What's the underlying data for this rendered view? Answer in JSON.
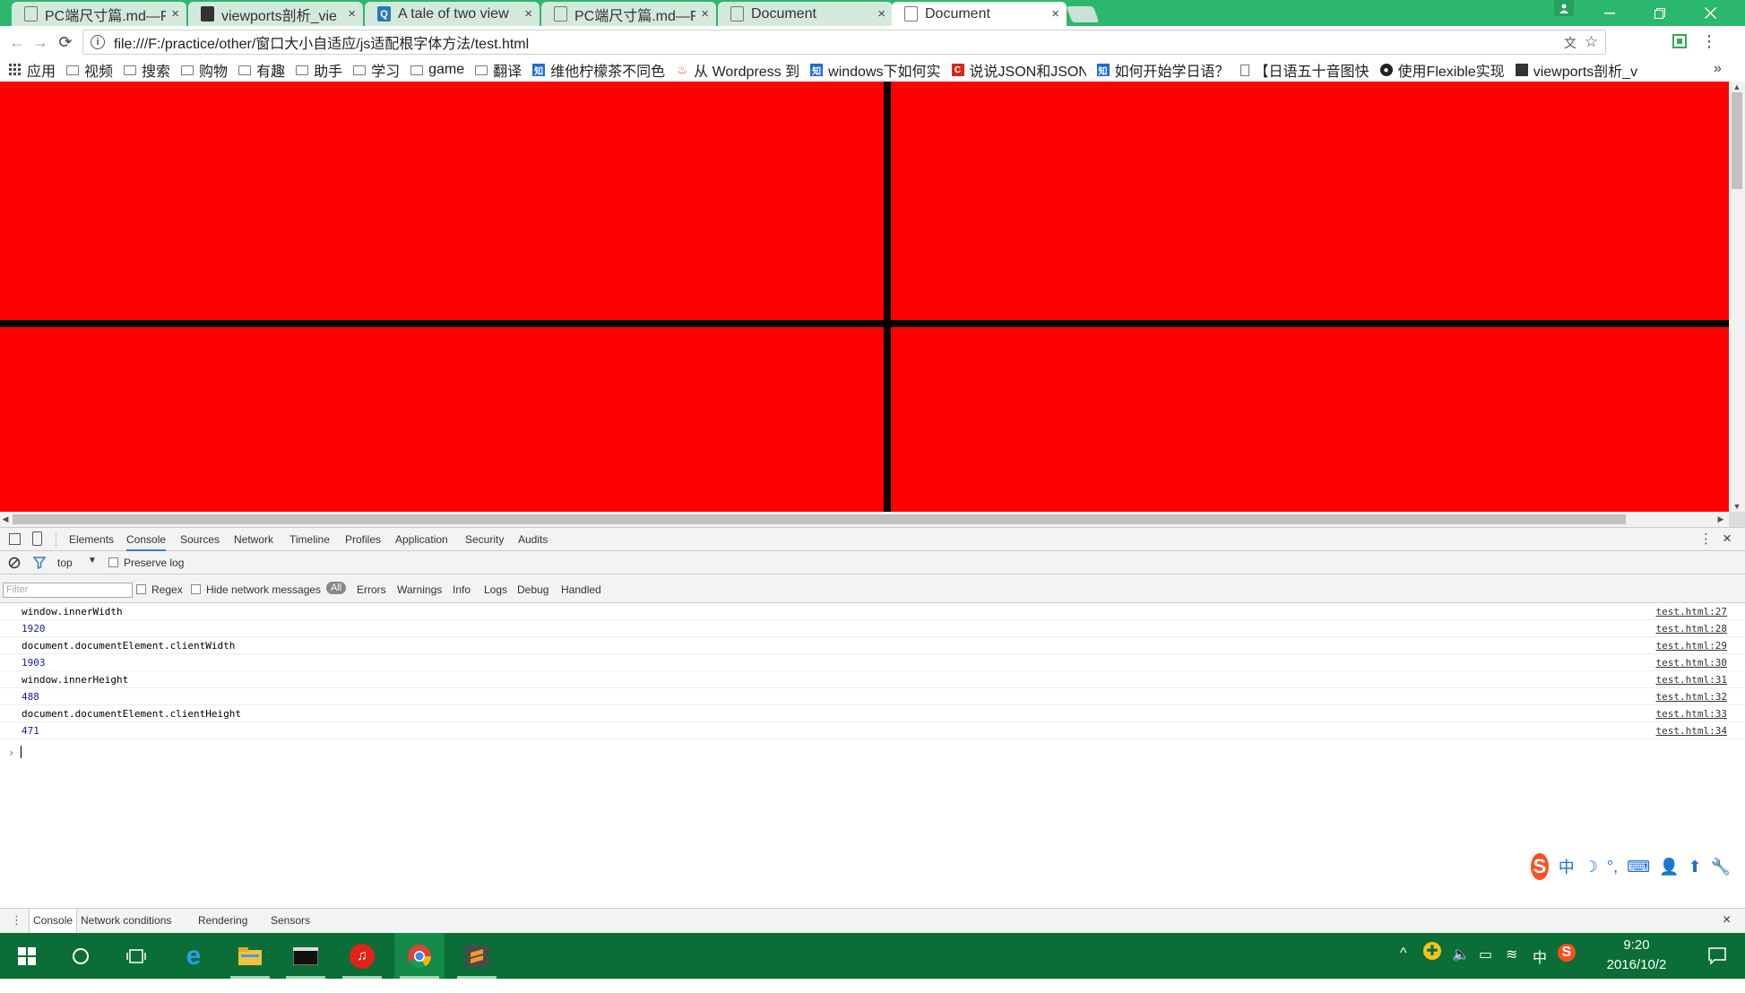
{
  "tabs": [
    {
      "label": "PC端尺寸篇.md—F",
      "icon": "document-icon"
    },
    {
      "label": "viewports剖析_vie",
      "icon": "site-favicon"
    },
    {
      "label": "A tale of two view",
      "icon": "q-favicon"
    },
    {
      "label": "PC端尺寸篇.md—F",
      "icon": "document-icon"
    },
    {
      "label": "Document",
      "icon": "document-icon"
    },
    {
      "label": "Document",
      "icon": "document-icon",
      "active": true
    }
  ],
  "toolbar": {
    "back": "←",
    "forward": "→",
    "reload": "⟳",
    "url": "file:///F:/practice/other/窗口大小自适应/js适配根字体方法/test.html",
    "info": "i",
    "translate": "文",
    "star": "☆",
    "ext": "■",
    "menu": "⋮"
  },
  "bookmarks": [
    {
      "label": "应用",
      "icon": "apps-grid-icon"
    },
    {
      "label": "视频",
      "icon": "folder-icon"
    },
    {
      "label": "搜索",
      "icon": "folder-icon"
    },
    {
      "label": "购物",
      "icon": "folder-icon"
    },
    {
      "label": "有趣",
      "icon": "folder-icon"
    },
    {
      "label": "助手",
      "icon": "folder-icon"
    },
    {
      "label": "学习",
      "icon": "folder-icon"
    },
    {
      "label": "game",
      "icon": "folder-icon"
    },
    {
      "label": "翻译",
      "icon": "folder-icon"
    },
    {
      "label": "维他柠檬茶不同色",
      "icon": "zhihu-icon"
    },
    {
      "label": "从 Wordpress 到",
      "icon": "flame-icon"
    },
    {
      "label": "windows下如何实",
      "icon": "zhihu-icon"
    },
    {
      "label": "说说JSON和JSON",
      "icon": "c-red-icon"
    },
    {
      "label": "如何开始学日语？",
      "icon": "zhihu-icon"
    },
    {
      "label": "【日语五十音图快",
      "icon": "page-icon"
    },
    {
      "label": "使用Flexible实现",
      "icon": "github-icon"
    },
    {
      "label": "viewports剖析_v",
      "icon": "site-favicon"
    }
  ],
  "bookmarks_more": "»",
  "devtools": {
    "tabs": [
      "Elements",
      "Console",
      "Sources",
      "Network",
      "Timeline",
      "Profiles",
      "Application",
      "Security",
      "Audits"
    ],
    "active_tab": "Console",
    "context": "top",
    "preserve_log": "Preserve log",
    "filter_placeholder": "Filter",
    "regex": "Regex",
    "hide_network": "Hide network messages",
    "levels": [
      "All",
      "Errors",
      "Warnings",
      "Info",
      "Logs",
      "Debug",
      "Handled"
    ],
    "close": "×",
    "more": "⋮"
  },
  "console_log": [
    {
      "msg": "window.innerWidth",
      "src": "test.html:27"
    },
    {
      "msg": "1920",
      "src": "test.html:28",
      "numeric": true
    },
    {
      "msg": "document.documentElement.clientWidth",
      "src": "test.html:29"
    },
    {
      "msg": "1903",
      "src": "test.html:30",
      "numeric": true
    },
    {
      "msg": "window.innerHeight",
      "src": "test.html:31"
    },
    {
      "msg": "488",
      "src": "test.html:32",
      "numeric": true
    },
    {
      "msg": "document.documentElement.clientHeight",
      "src": "test.html:33"
    },
    {
      "msg": "471",
      "src": "test.html:34",
      "numeric": true
    }
  ],
  "console_prompt": "›",
  "drawer": {
    "tabs": [
      "Console",
      "Network conditions",
      "Rendering",
      "Sensors"
    ],
    "active": "Console",
    "close": "×"
  },
  "ime": {
    "logo": "S",
    "mode": "中",
    "items": [
      "☽",
      "°,",
      "⌨",
      "👤",
      "⬆",
      "🔧"
    ]
  },
  "taskbar": {
    "tray": [
      "^",
      "✚",
      "🔈",
      "▭",
      "≋",
      "中",
      "S"
    ],
    "time": "9:20",
    "date": "2016/10/2"
  },
  "colors": {
    "page_bg": "#ff0000",
    "divider": "#000000",
    "tabstrip": "#2cb76f",
    "taskbar": "#0a6e36"
  }
}
